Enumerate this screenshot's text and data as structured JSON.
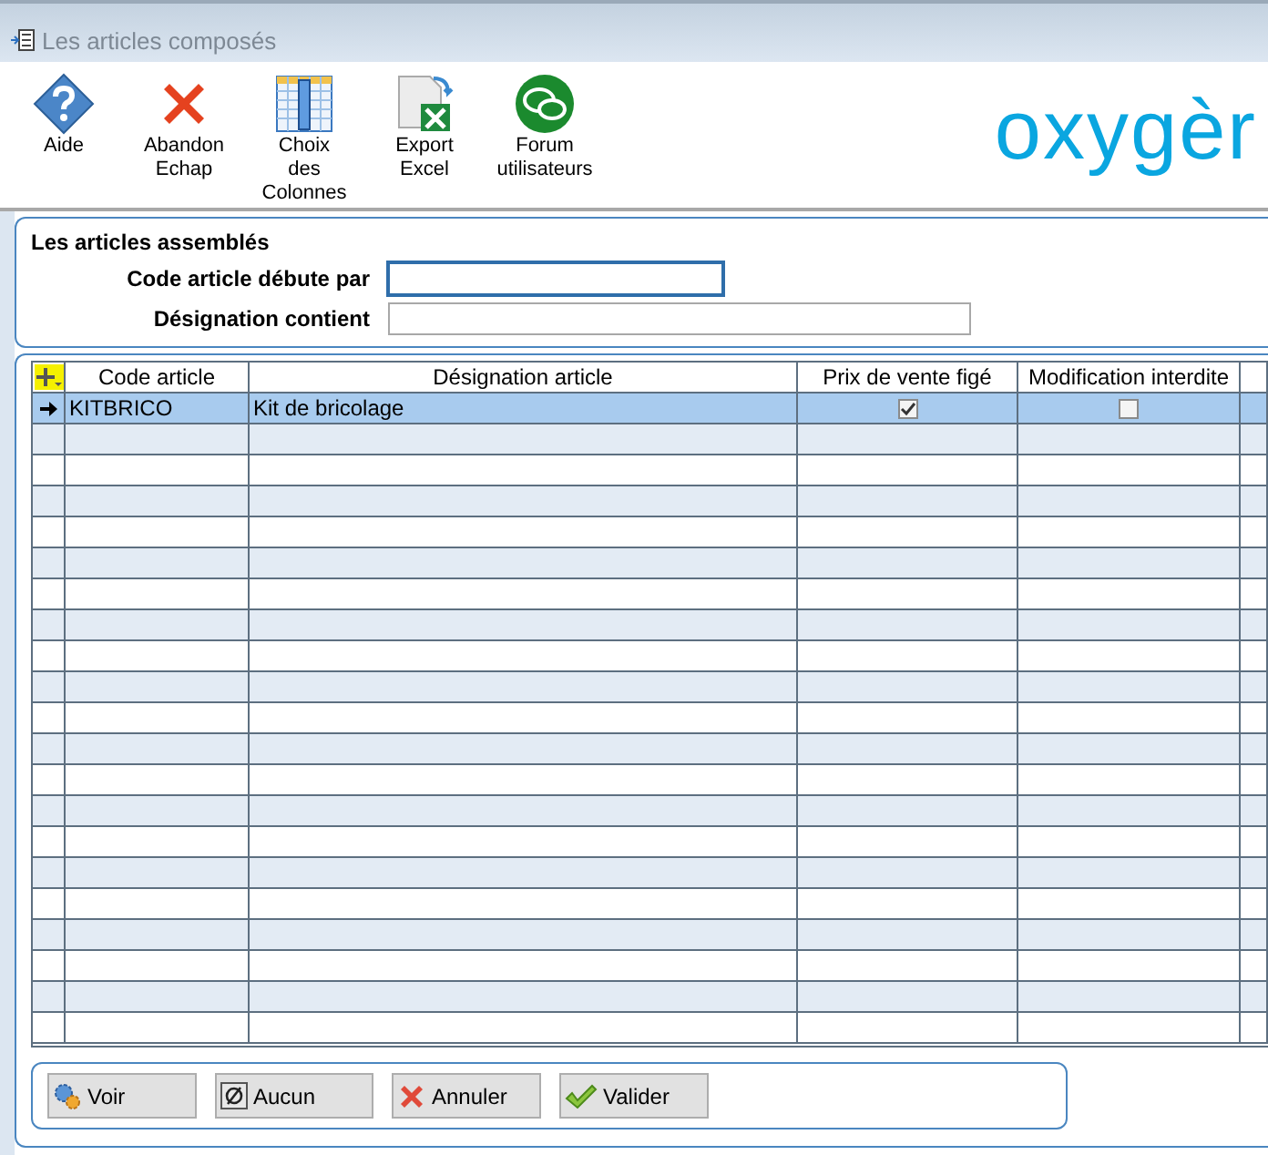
{
  "window": {
    "title": "Les articles composés"
  },
  "toolbar": [
    {
      "kind": "help",
      "label": "Aide"
    },
    {
      "kind": "cancel",
      "label": "Abandon\nEchap"
    },
    {
      "kind": "columns",
      "label": "Choix\ndes\nColonnes"
    },
    {
      "kind": "excel",
      "label": "Export\nExcel"
    },
    {
      "kind": "forum",
      "label": "Forum\nutilisateurs"
    }
  ],
  "logo": "oxygèr",
  "filter": {
    "title": "Les articles assemblés",
    "fields": [
      {
        "label": "Code article débute par",
        "focused": true
      },
      {
        "label": "Désignation contient",
        "focused": false
      }
    ]
  },
  "table": {
    "columns": [
      "Code article",
      "Désignation article",
      "Prix de vente figé",
      "Modification interdite"
    ],
    "rows": [
      {
        "code": "KITBRICO",
        "designation": "Kit de bricolage",
        "prix_fige": true,
        "modification_interdite": false,
        "selected": true
      }
    ]
  },
  "buttons": [
    {
      "kind": "view",
      "label": "Voir"
    },
    {
      "kind": "none",
      "label": "Aucun"
    },
    {
      "kind": "cancel",
      "label": "Annuler"
    },
    {
      "kind": "ok",
      "label": "Valider"
    }
  ]
}
